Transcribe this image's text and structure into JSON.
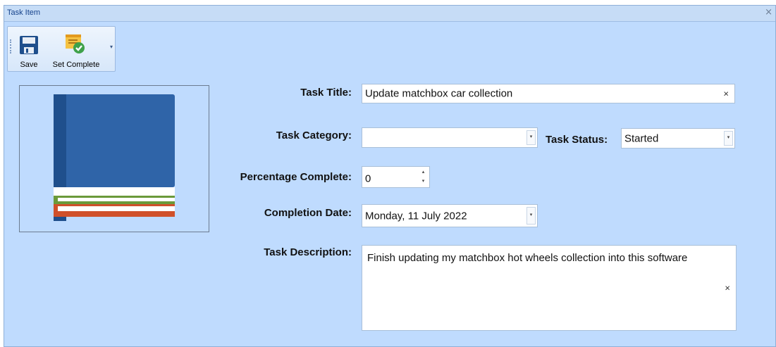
{
  "window": {
    "title": "Task Item",
    "close_glyph": "×"
  },
  "toolbar": {
    "save_label": "Save",
    "save_icon": "floppy-disk-icon",
    "set_complete_label": "Set Complete",
    "set_complete_icon": "sticky-note-check-icon"
  },
  "form": {
    "task_title_label": "Task Title:",
    "task_title_value": "Update matchbox car collection",
    "task_category_label": "Task Category:",
    "task_category_value": "",
    "task_status_label": "Task Status:",
    "task_status_value": "Started",
    "percentage_label": "Percentage Complete:",
    "percentage_value": "0",
    "completion_date_label": "Completion Date:",
    "completion_date_value": "Monday, 11 July 2022",
    "description_label": "Task Description:",
    "description_value": "Finish updating my matchbox hot wheels collection into this software",
    "clear_glyph": "×"
  },
  "colors": {
    "background": "#bfdbfe",
    "book_cover": "#2f64a8",
    "book_green": "#6a9a3a",
    "book_red": "#d0502a"
  }
}
